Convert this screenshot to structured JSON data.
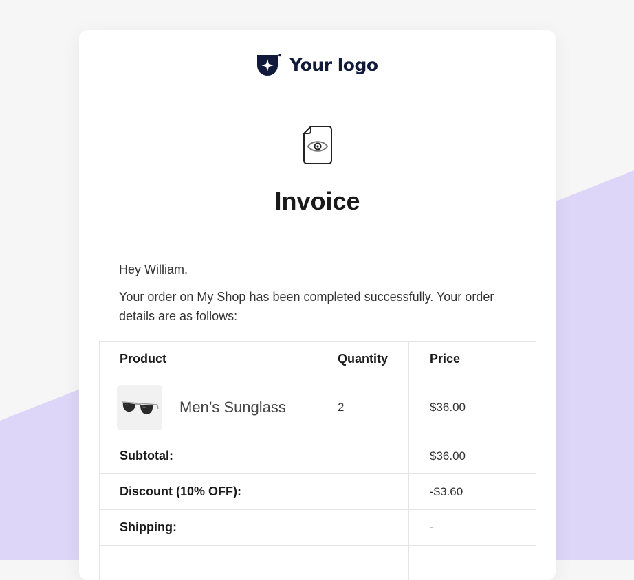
{
  "brand": {
    "logo_text": "Your logo",
    "logo_color": "#111a3a",
    "accent_bg": "#ddd6f8"
  },
  "invoice": {
    "icon": "document-eye-icon",
    "title": "Invoice",
    "greeting": "Hey William,",
    "message": "Your order on My Shop has been completed successfully. Your order details are as follows:"
  },
  "table": {
    "headers": [
      "Product",
      "Quantity",
      "Price"
    ],
    "items": [
      {
        "image_icon": "sunglasses-icon",
        "name": "Men’s Sunglass",
        "quantity": "2",
        "price": "$36.00"
      }
    ],
    "summary": [
      {
        "label": "Subtotal:",
        "value": "$36.00"
      },
      {
        "label": "Discount (10% OFF):",
        "value": "-$3.60"
      },
      {
        "label": "Shipping:",
        "value": "-"
      }
    ]
  }
}
